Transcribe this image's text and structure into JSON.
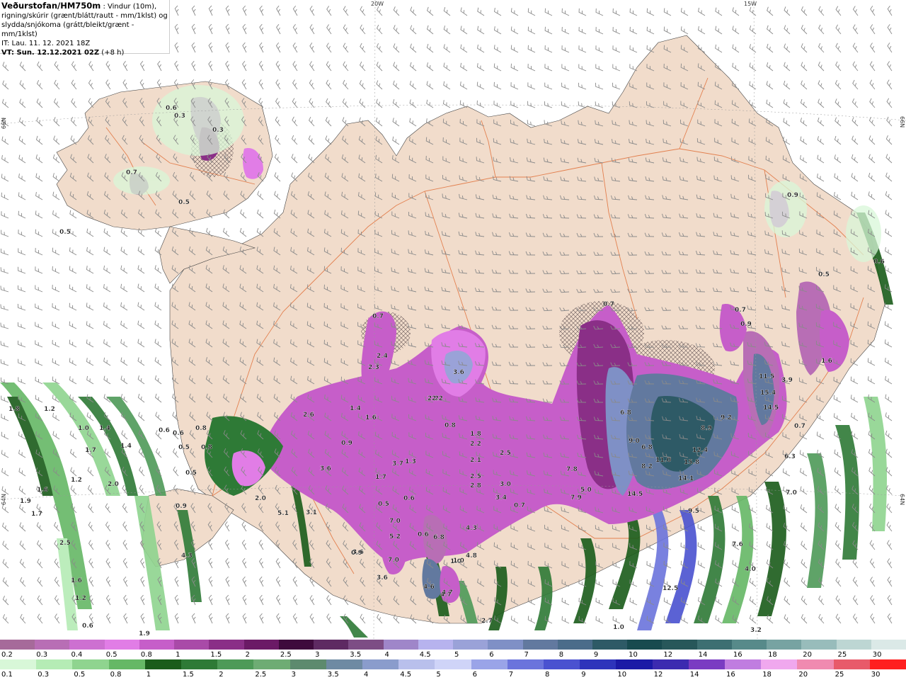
{
  "header": {
    "title": "Veðurstofan/HM750m",
    "title_suffix": " : Vindur (10m),",
    "line2": "rigning/skúrir (grænt/blátt/rautt - mm/1klst) og",
    "line3": "slydda/snjókoma (grátt/bleikt/grænt - mm/1klst)",
    "line4": "IT: Lau. 11. 12. 2021 18Z",
    "line5_bold": "VT: Sun. 12.12.2021 02Z",
    "line5_rest": " (+8 h)"
  },
  "coords": {
    "top_20w": "20W",
    "top_15w": "15W",
    "left_66n": "66N",
    "left_64n": "64N",
    "right_66n": "66N",
    "right_64n": "64N"
  },
  "colors": {
    "sea": "#ffffff",
    "land": "#f1dccb",
    "roads": "#e0703a",
    "barbs": "#8a8a8a"
  },
  "legend_snow": {
    "labels": [
      "0.2",
      "0.3",
      "0.4",
      "0.5",
      "0.8",
      "1",
      "1.5",
      "2",
      "2.5",
      "3",
      "3.5",
      "4",
      "4.5",
      "5",
      "6",
      "7",
      "8",
      "9",
      "10",
      "12",
      "14",
      "16",
      "18",
      "20",
      "25",
      "30"
    ],
    "colors": [
      "#a66a9a",
      "#b86eb5",
      "#cd70d1",
      "#e17de6",
      "#c65ec9",
      "#a94aa8",
      "#8a2f87",
      "#6b1a66",
      "#3e0a3c",
      "#5e2a62",
      "#7d4d85",
      "#9f86c9",
      "#b7b3ee",
      "#9aa2d8",
      "#7f90c6",
      "#62799f",
      "#4b6c8a",
      "#2e5a66",
      "#184a4f",
      "#27575a",
      "#3d6f72",
      "#578a8a",
      "#77a3a2",
      "#98bcbb",
      "#bdd6d3",
      "#dbe9e7"
    ]
  },
  "legend_rain": {
    "labels": [
      "0.1",
      "0.3",
      "0.5",
      "0.8",
      "1",
      "1.5",
      "2",
      "2.5",
      "3",
      "3.5",
      "4",
      "4.5",
      "5",
      "6",
      "7",
      "8",
      "9",
      "10",
      "12",
      "14",
      "16",
      "18",
      "20",
      "25",
      "30"
    ],
    "colors": [
      "#d8f7d8",
      "#b5ecb5",
      "#8fd48f",
      "#66b866",
      "#1a5c1a",
      "#2e7a36",
      "#4e9a58",
      "#6eac74",
      "#5d8a6e",
      "#6e8aa3",
      "#8a9ccc",
      "#b9c0ec",
      "#cfd4f8",
      "#9aa4e8",
      "#6b74dc",
      "#4a52d0",
      "#2e34bb",
      "#1c1aa6",
      "#3c2bb0",
      "#7a3cc2",
      "#c07de0",
      "#f0a8ee",
      "#f08ab0",
      "#e85a6a",
      "#ff1f1f"
    ]
  },
  "precip_labels": [
    {
      "t": "1.8"
    },
    {
      "t": "1.2"
    },
    {
      "t": "1.0"
    },
    {
      "t": "1.4"
    },
    {
      "t": "1.7"
    },
    {
      "t": "1.4"
    },
    {
      "t": "0.6"
    },
    {
      "t": "0.6"
    },
    {
      "t": "0.5"
    },
    {
      "t": "0.5"
    },
    {
      "t": "0.8"
    },
    {
      "t": "0.8"
    },
    {
      "t": "1.2"
    },
    {
      "t": "2.0"
    },
    {
      "t": "1.6"
    },
    {
      "t": "1.9"
    },
    {
      "t": "1.7"
    },
    {
      "t": "2.5"
    },
    {
      "t": "1.6"
    },
    {
      "t": "1.2"
    },
    {
      "t": "0.6"
    },
    {
      "t": "4.3"
    },
    {
      "t": "0.9"
    },
    {
      "t": "1.9"
    },
    {
      "t": "0.6"
    },
    {
      "t": "0.3"
    },
    {
      "t": "0.3"
    },
    {
      "t": "0.7"
    },
    {
      "t": "0.5"
    },
    {
      "t": "0.5"
    },
    {
      "t": "0.9"
    },
    {
      "t": "0.7"
    },
    {
      "t": "2.4"
    },
    {
      "t": "2.3"
    },
    {
      "t": "1.4"
    },
    {
      "t": "1.6"
    },
    {
      "t": "2.6"
    },
    {
      "t": "2.2"
    },
    {
      "t": "3.6"
    },
    {
      "t": "2.2"
    },
    {
      "t": "0.8"
    },
    {
      "t": "1.8"
    },
    {
      "t": "2.2"
    },
    {
      "t": "2.1"
    },
    {
      "t": "2.5"
    },
    {
      "t": "2.8"
    },
    {
      "t": "3.4"
    },
    {
      "t": "2.5"
    },
    {
      "t": "3.0"
    },
    {
      "t": "0.7"
    },
    {
      "t": "3.7"
    },
    {
      "t": "1.3"
    },
    {
      "t": "1.7"
    },
    {
      "t": "0.5"
    },
    {
      "t": "0.6"
    },
    {
      "t": "7.0"
    },
    {
      "t": "5.2"
    },
    {
      "t": "0.6"
    },
    {
      "t": "6.8"
    },
    {
      "t": "7.0"
    },
    {
      "t": "3.6"
    },
    {
      "t": "4.6"
    },
    {
      "t": "4.7"
    },
    {
      "t": "1.0"
    },
    {
      "t": "4.8"
    },
    {
      "t": "4.3"
    },
    {
      "t": "3.6"
    },
    {
      "t": "0.9"
    },
    {
      "t": "2.7"
    },
    {
      "t": "1.0"
    },
    {
      "t": "6.8"
    },
    {
      "t": "9.0"
    },
    {
      "t": "6.8"
    },
    {
      "t": "8.2"
    },
    {
      "t": "11.0"
    },
    {
      "t": "8.9"
    },
    {
      "t": "9.2"
    },
    {
      "t": "12.4"
    },
    {
      "t": "15.8"
    },
    {
      "t": "14.5"
    },
    {
      "t": "14.1"
    },
    {
      "t": "7.8"
    },
    {
      "t": "7.9"
    },
    {
      "t": "5.0"
    },
    {
      "t": "9.5"
    },
    {
      "t": "12.5"
    },
    {
      "t": "11.5"
    },
    {
      "t": "15.4"
    },
    {
      "t": "14.5"
    },
    {
      "t": "3.9"
    },
    {
      "t": "6.3"
    },
    {
      "t": "7.0"
    },
    {
      "t": "7.6"
    },
    {
      "t": "4.0"
    },
    {
      "t": "3.2"
    },
    {
      "t": "0.9"
    },
    {
      "t": "0.7"
    },
    {
      "t": "0.9"
    },
    {
      "t": "0.7"
    },
    {
      "t": "0.5"
    },
    {
      "t": "1.6"
    },
    {
      "t": "0.6"
    },
    {
      "t": "4.7"
    },
    {
      "t": "1.0"
    },
    {
      "t": "0.7"
    },
    {
      "t": "0.9"
    },
    {
      "t": "3.6"
    },
    {
      "t": "2.0"
    },
    {
      "t": "5.1"
    },
    {
      "t": "3.1"
    }
  ]
}
